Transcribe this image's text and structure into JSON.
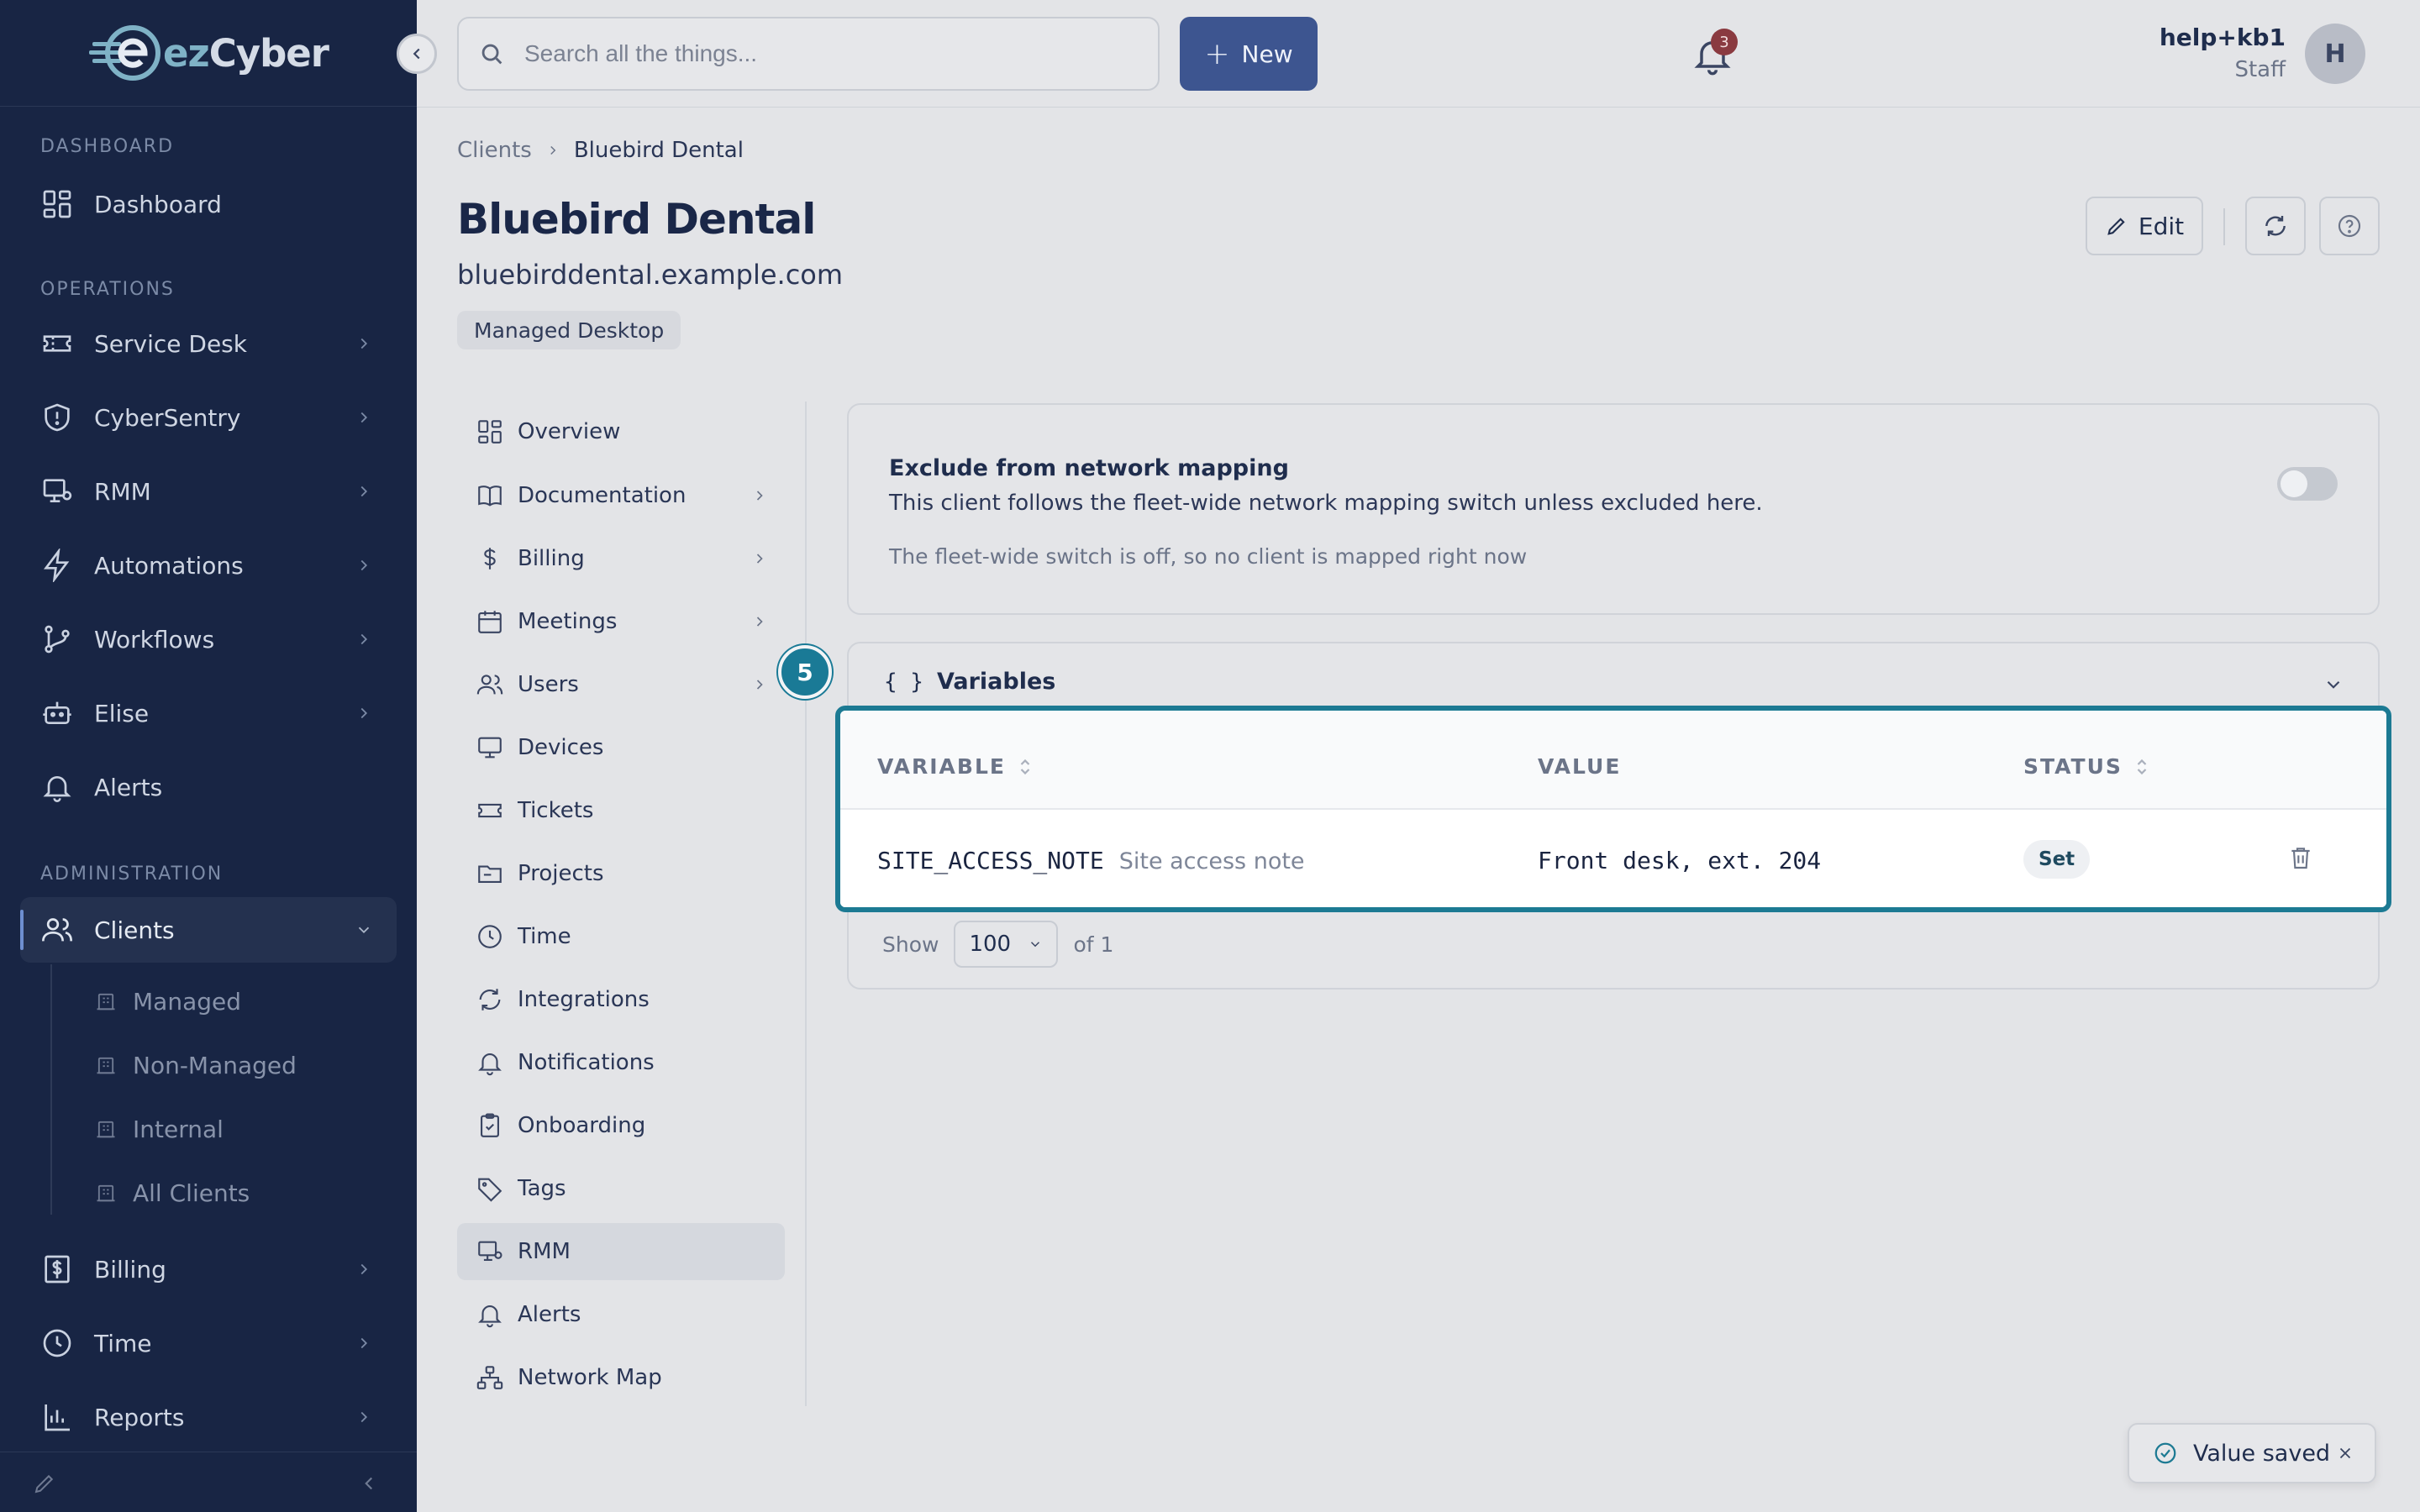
{
  "brand": {
    "name_prefix": "ez",
    "name_suffix": "Cyber"
  },
  "search": {
    "placeholder": "Search all the things..."
  },
  "topbar": {
    "new_label": "New",
    "notifications_count": "3"
  },
  "user": {
    "name": "help+kb1",
    "role": "Staff",
    "initial": "H"
  },
  "sidebar": {
    "sections": {
      "dashboard": "DASHBOARD",
      "operations": "OPERATIONS",
      "administration": "ADMINISTRATION"
    },
    "items": {
      "dashboard": "Dashboard",
      "service_desk": "Service Desk",
      "cybersentry": "CyberSentry",
      "rmm": "RMM",
      "automations": "Automations",
      "workflows": "Workflows",
      "elise": "Elise",
      "alerts": "Alerts",
      "clients": "Clients",
      "billing": "Billing",
      "time": "Time",
      "reports": "Reports"
    },
    "client_subitems": {
      "managed": "Managed",
      "non_managed": "Non-Managed",
      "internal": "Internal",
      "all": "All Clients"
    }
  },
  "breadcrumb": {
    "root": "Clients",
    "current": "Bluebird Dental"
  },
  "client": {
    "name": "Bluebird Dental",
    "domain": "bluebirddental.example.com",
    "tag": "Managed Desktop"
  },
  "header_actions": {
    "edit_label": "Edit"
  },
  "subnav": {
    "overview": "Overview",
    "documentation": "Documentation",
    "billing": "Billing",
    "meetings": "Meetings",
    "users": "Users",
    "devices": "Devices",
    "tickets": "Tickets",
    "projects": "Projects",
    "time": "Time",
    "integrations": "Integrations",
    "notifications": "Notifications",
    "onboarding": "Onboarding",
    "tags": "Tags",
    "rmm": "RMM",
    "alerts": "Alerts",
    "network_map": "Network Map"
  },
  "network_mapping": {
    "title": "Exclude from network mapping",
    "description": "This client follows the fleet-wide network mapping switch unless excluded here.",
    "note": "The fleet-wide switch is off, so no client is mapped right now",
    "enabled": false
  },
  "variables": {
    "braces": "{ }",
    "title": "Variables",
    "step_number": "5",
    "columns": {
      "variable": "VARIABLE",
      "value": "VALUE",
      "status": "STATUS"
    },
    "rows": [
      {
        "name": "SITE_ACCESS_NOTE",
        "description": "Site access note",
        "value": "Front desk, ext. 204",
        "status": "Set"
      }
    ],
    "pager": {
      "show_label": "Show",
      "page_size": "100",
      "of_label": "of 1"
    }
  },
  "toast": {
    "message": "Value saved"
  },
  "colors": {
    "sidebar_bg": "#182544",
    "primary": "#3d5590",
    "highlight": "#1c7a93",
    "badge": "#8a3a40"
  }
}
